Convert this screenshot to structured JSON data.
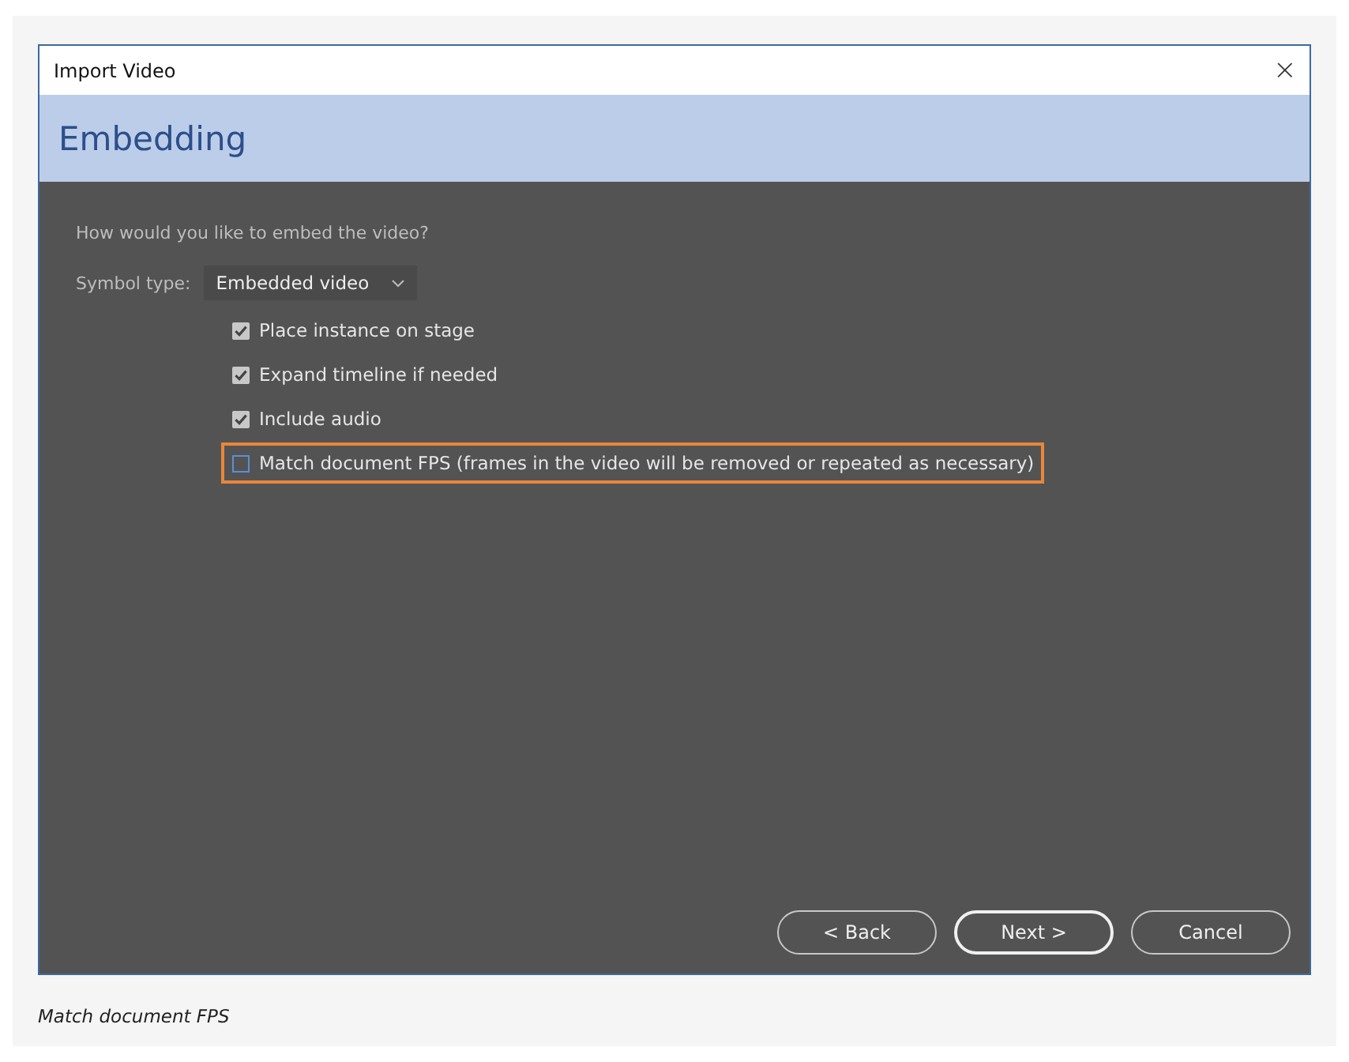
{
  "window": {
    "title": "Import Video",
    "close": "×"
  },
  "header": {
    "title": "Embedding"
  },
  "prompt": "How would you like to embed the video?",
  "symbol_type": {
    "label": "Symbol type:",
    "value": "Embedded video"
  },
  "options": [
    {
      "label": "Place instance on stage",
      "checked": true,
      "highlighted": false
    },
    {
      "label": "Expand timeline if needed",
      "checked": true,
      "highlighted": false
    },
    {
      "label": "Include audio",
      "checked": true,
      "highlighted": false
    },
    {
      "label": "Match document FPS (frames in the video will be removed or repeated as necessary)",
      "checked": false,
      "highlighted": true
    }
  ],
  "buttons": [
    {
      "label": "< Back",
      "default": false
    },
    {
      "label": "Next >",
      "default": true
    },
    {
      "label": "Cancel",
      "default": false
    }
  ],
  "caption": "Match document FPS"
}
